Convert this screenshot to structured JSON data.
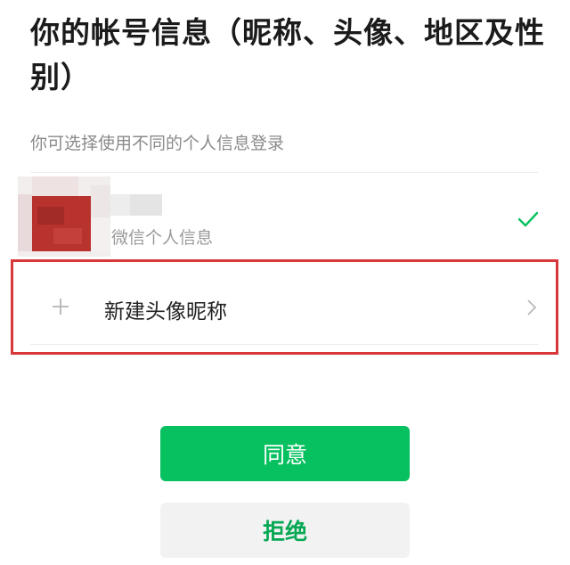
{
  "header": {
    "title": "你的帐号信息（昵称、头像、地区及性别）",
    "subtitle": "你可选择使用不同的个人信息登录"
  },
  "account": {
    "subtitle": "微信个人信息",
    "selected": true,
    "check_icon": "checkmark-icon",
    "check_color": "#07c160"
  },
  "new_profile": {
    "label": "新建头像昵称",
    "icon": "plus-icon",
    "trailing_icon": "chevron-right-icon"
  },
  "buttons": {
    "agree_label": "同意",
    "reject_label": "拒绝"
  },
  "colors": {
    "primary": "#07c160",
    "highlight_border": "#d9383a"
  }
}
